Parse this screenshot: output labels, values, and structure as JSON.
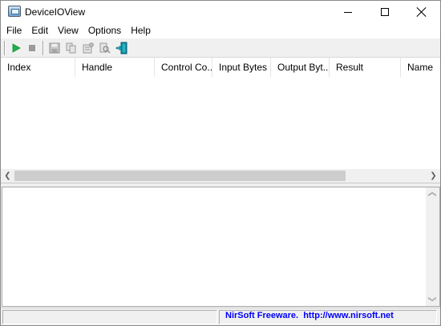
{
  "window": {
    "title": "DeviceIOView",
    "minimize_icon": "minimize-icon",
    "maximize_icon": "maximize-icon",
    "close_icon": "close-icon"
  },
  "menu": {
    "items": [
      "File",
      "Edit",
      "View",
      "Options",
      "Help"
    ]
  },
  "toolbar": {
    "buttons": [
      {
        "icon": "play-icon",
        "color": "#22b14c",
        "enabled": true
      },
      {
        "icon": "stop-icon",
        "color": "#9a9a9a",
        "enabled": false
      },
      {
        "icon": "save-icon",
        "enabled": false
      },
      {
        "icon": "copy-icon",
        "enabled": false
      },
      {
        "icon": "properties-icon",
        "enabled": false
      },
      {
        "icon": "find-icon",
        "enabled": false
      },
      {
        "icon": "exit-icon",
        "color": "#17a5b8",
        "enabled": true
      }
    ]
  },
  "list": {
    "columns": [
      "Index",
      "Handle",
      "Control Co...",
      "Input Bytes",
      "Output Byt...",
      "Result",
      "Name"
    ],
    "rows": []
  },
  "statusbar": {
    "text": "NirSoft Freeware.  http://www.nirsoft.net",
    "link_color": "#0000ff"
  }
}
